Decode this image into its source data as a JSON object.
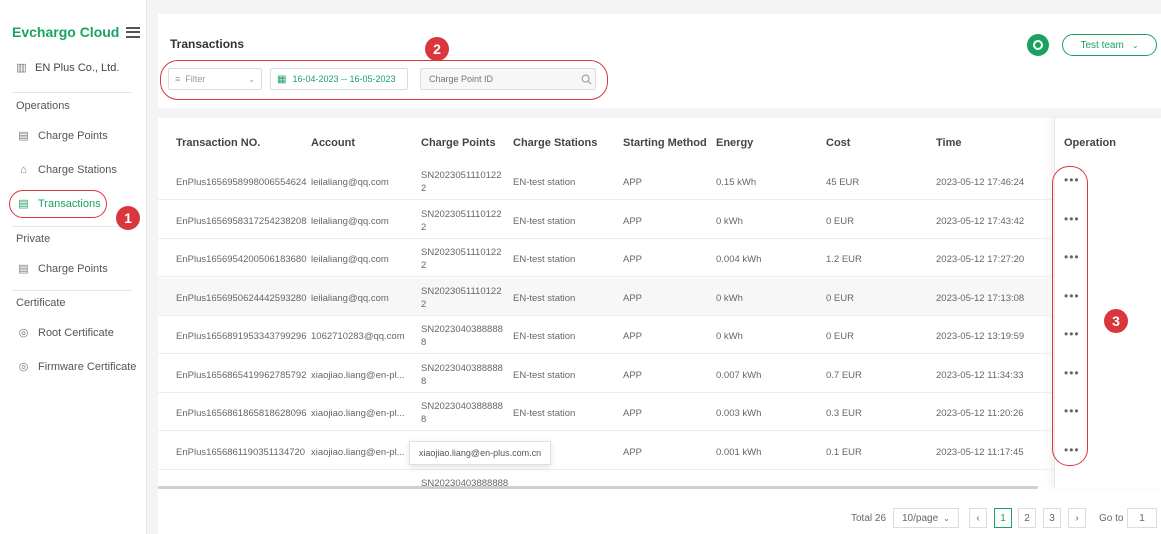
{
  "sidebar": {
    "logo": "Evchargo Cloud",
    "company": "EN Plus Co., Ltd.",
    "sections": {
      "operations": "Operations",
      "private": "Private",
      "certificate": "Certificate"
    },
    "items": {
      "charge_points": "Charge Points",
      "charge_stations": "Charge Stations",
      "transactions": "Transactions",
      "private_charge_points": "Charge Points",
      "root_certificate": "Root Certificate",
      "firmware_certificate": "Firmware Certificate"
    }
  },
  "header": {
    "title": "Transactions",
    "filter_placeholder": "Filter",
    "date_range": "16-04-2023 -- 16-05-2023",
    "search_placeholder": "Charge Point ID",
    "team": "Test team"
  },
  "annotations": {
    "one": "1",
    "two": "2",
    "three": "3"
  },
  "table": {
    "columns": {
      "transaction_no": "Transaction NO.",
      "account": "Account",
      "charge_points": "Charge Points",
      "charge_stations": "Charge Stations",
      "starting_method": "Starting Method",
      "energy": "Energy",
      "cost": "Cost",
      "time": "Time",
      "operation": "Operation"
    },
    "rows": [
      {
        "txn": "EnPlus1656958998006554624",
        "account": "leilaliang@qq.com",
        "cp": "SN20230511101222",
        "station": "EN-test station",
        "method": "APP",
        "energy": "0.15 kWh",
        "cost": "45 EUR",
        "time": "2023-05-12 17:46:24",
        "op": "•••"
      },
      {
        "txn": "EnPlus1656958317254238208",
        "account": "leilaliang@qq.com",
        "cp": "SN20230511101222",
        "station": "EN-test station",
        "method": "APP",
        "energy": "0 kWh",
        "cost": "0 EUR",
        "time": "2023-05-12 17:43:42",
        "op": "•••"
      },
      {
        "txn": "EnPlus1656954200506183680",
        "account": "leilaliang@qq.com",
        "cp": "SN20230511101222",
        "station": "EN-test station",
        "method": "APP",
        "energy": "0.004 kWh",
        "cost": "1.2 EUR",
        "time": "2023-05-12 17:27:20",
        "op": "•••"
      },
      {
        "txn": "EnPlus1656950624442593280",
        "account": "leilaliang@qq.com",
        "cp": "SN20230511101222",
        "station": "EN-test station",
        "method": "APP",
        "energy": "0 kWh",
        "cost": "0 EUR",
        "time": "2023-05-12 17:13:08",
        "op": "•••"
      },
      {
        "txn": "EnPlus1656891953343799296",
        "account": "1062710283@qq.com",
        "cp": "SN20230403888888",
        "station": "EN-test station",
        "method": "APP",
        "energy": "0 kWh",
        "cost": "0 EUR",
        "time": "2023-05-12 13:19:59",
        "op": "•••"
      },
      {
        "txn": "EnPlus1656865419962785792",
        "account": "xiaojiao.liang@en-pl...",
        "cp": "SN20230403888888",
        "station": "EN-test station",
        "method": "APP",
        "energy": "0.007 kWh",
        "cost": "0.7 EUR",
        "time": "2023-05-12 11:34:33",
        "op": "•••"
      },
      {
        "txn": "EnPlus1656861865818628096",
        "account": "xiaojiao.liang@en-pl...",
        "cp": "SN20230403888888",
        "station": "EN-test station",
        "method": "APP",
        "energy": "0.003 kWh",
        "cost": "0.3 EUR",
        "time": "2023-05-12 11:20:26",
        "op": "•••"
      },
      {
        "txn": "EnPlus1656861190351134720",
        "account": "xiaojiao.liang@en-pl...",
        "cp": "",
        "station": "tation",
        "method": "APP",
        "energy": "0.001 kWh",
        "cost": "0.1 EUR",
        "time": "2023-05-12 11:17:45",
        "op": "•••"
      }
    ],
    "partial_cp": "SN20230403888888",
    "tooltip": "xiaojiao.liang@en-plus.com.cn"
  },
  "pagination": {
    "total": "Total 26",
    "page_size": "10/page",
    "pages": [
      "1",
      "2",
      "3"
    ],
    "goto_label": "Go to",
    "goto_value": "1"
  },
  "colors": {
    "brand": "#1aa260",
    "annotation": "#d9363e"
  }
}
